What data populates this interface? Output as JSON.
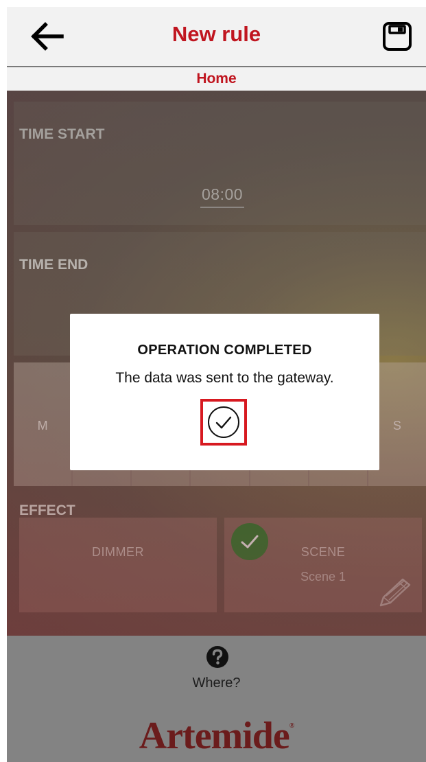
{
  "header": {
    "title": "New rule",
    "subtitle": "Home",
    "back_icon": "arrow-left-icon",
    "save_icon": "floppy-disk-icon"
  },
  "schedule": {
    "time_start_label": "TIME START",
    "time_start_value": "08:00",
    "time_end_label": "TIME END"
  },
  "days": [
    {
      "label": "M"
    },
    {
      "label": ""
    },
    {
      "label": ""
    },
    {
      "label": ""
    },
    {
      "label": ""
    },
    {
      "label": ""
    },
    {
      "label": "S"
    }
  ],
  "effect": {
    "title": "EFFECT",
    "dimmer_label": "DIMMER",
    "scene_label": "SCENE",
    "scene_name": "Scene 1",
    "scene_selected": true
  },
  "footer": {
    "help_icon": "question-circle-icon",
    "help_label": "Where?",
    "brand": "Artemide",
    "brand_mark": "®"
  },
  "dialog": {
    "title": "OPERATION COMPLETED",
    "message": "The data was sent to the gateway.",
    "confirm_icon": "check-circle-icon"
  },
  "colors": {
    "accent_red": "#c0151f",
    "highlight_red": "#d71920",
    "selected_green": "#2c6e2b",
    "brand_red": "#6b1c1c"
  }
}
